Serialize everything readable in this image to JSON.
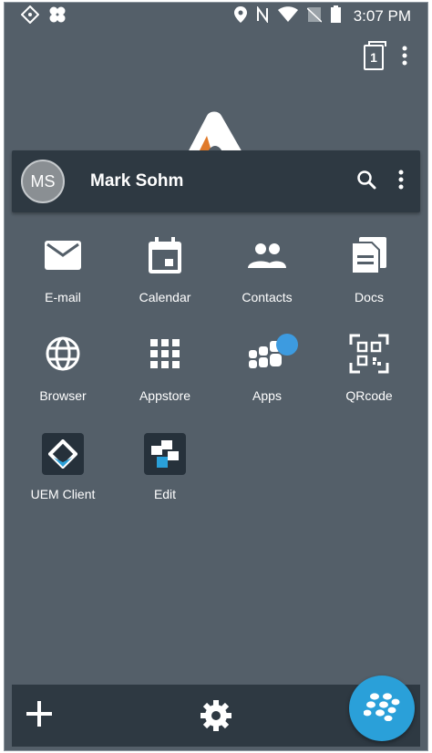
{
  "status_bar": {
    "time": "3:07 PM",
    "icons": [
      "diamond-nav-icon",
      "clover-icon",
      "location-icon",
      "nfc-icon",
      "wifi-icon",
      "no-sim-icon",
      "battery-icon"
    ]
  },
  "top_actions": {
    "tab_count": "1",
    "menu_icon": "more-vert-icon"
  },
  "header": {
    "avatar_initials": "MS",
    "user_name": "Mark Sohm",
    "icons": [
      "search-icon",
      "more-vert-icon"
    ]
  },
  "apps": [
    {
      "label": "E-mail",
      "icon": "mail-icon"
    },
    {
      "label": "Calendar",
      "icon": "calendar-icon"
    },
    {
      "label": "Contacts",
      "icon": "contacts-icon"
    },
    {
      "label": "Docs",
      "icon": "docs-icon"
    },
    {
      "label": "Browser",
      "icon": "globe-icon"
    },
    {
      "label": "Appstore",
      "icon": "grid-icon"
    },
    {
      "label": "Apps",
      "icon": "apps-cluster-icon"
    },
    {
      "label": "QRcode",
      "icon": "qrcode-icon"
    },
    {
      "label": "UEM Client",
      "icon": "uem-client-icon"
    },
    {
      "label": "Edit",
      "icon": "edit-app-icon"
    }
  ],
  "bottom_bar": {
    "add_icon": "plus-icon",
    "settings_icon": "gear-icon",
    "fab_icon": "blackberry-icon"
  },
  "colors": {
    "background": "#545f69",
    "bar": "#2e3942",
    "accent": "#2aa0d9",
    "badge": "#3d9be0"
  }
}
